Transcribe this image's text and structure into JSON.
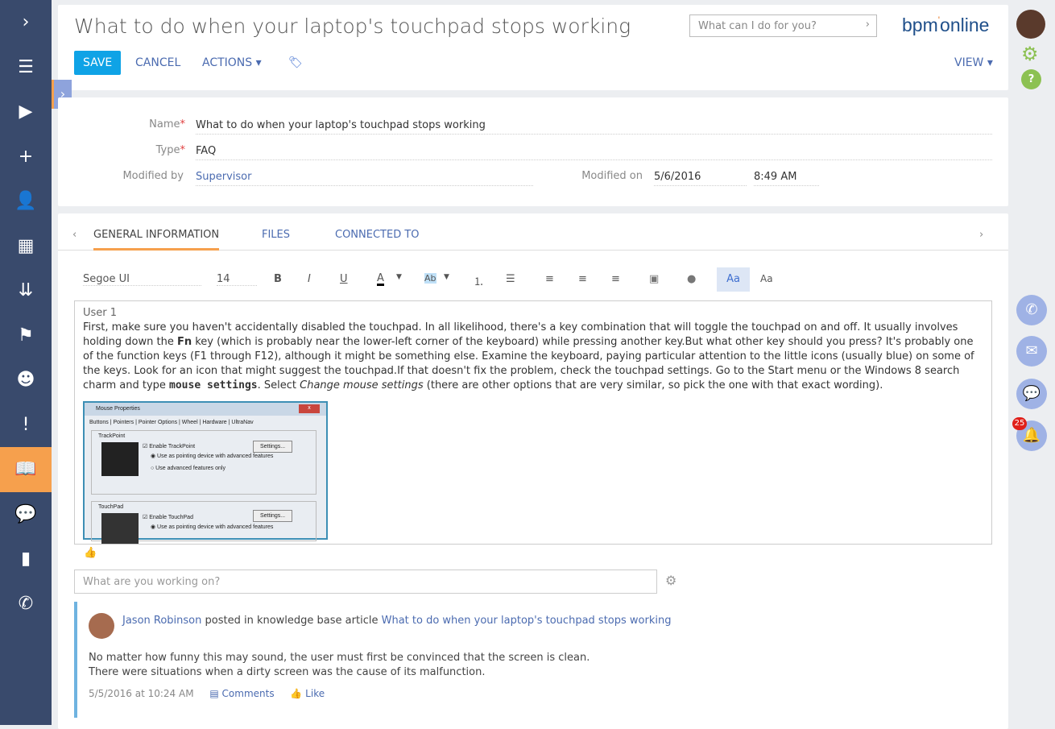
{
  "sidebar": {
    "items": [
      {
        "icon": "chevron-right-icon",
        "glyph": "›"
      },
      {
        "icon": "menu-icon",
        "glyph": "☰"
      },
      {
        "icon": "play-icon",
        "glyph": "▶"
      },
      {
        "icon": "plus-icon",
        "glyph": "+"
      },
      {
        "icon": "contact-icon",
        "glyph": "👤"
      },
      {
        "icon": "accounts-icon",
        "glyph": "▦"
      },
      {
        "icon": "leads-icon",
        "glyph": "⇊"
      },
      {
        "icon": "flag-icon",
        "glyph": "⚑"
      },
      {
        "icon": "agent-icon",
        "glyph": "☻"
      },
      {
        "icon": "cases-icon",
        "glyph": "!"
      },
      {
        "icon": "knowledge-base-icon",
        "glyph": "📖",
        "active": true
      },
      {
        "icon": "feed-icon",
        "glyph": "💬"
      },
      {
        "icon": "analytics-icon",
        "glyph": "▮"
      },
      {
        "icon": "phone-icon",
        "glyph": "✆"
      }
    ]
  },
  "header": {
    "title": "What to do when your laptop's touchpad stops working",
    "save": "SAVE",
    "cancel": "CANCEL",
    "actions": "ACTIONS ▾",
    "view": "VIEW ▾",
    "search_placeholder": "What can I do for you?",
    "logo": "bpm'online",
    "accent": "#0fa3e6"
  },
  "record": {
    "name_label": "Name",
    "name": "What to do when your laptop's touchpad stops working",
    "type_label": "Type",
    "type": "FAQ",
    "modified_by_label": "Modified by",
    "modified_by": "Supervisor",
    "modified_on_label": "Modified on",
    "modified_date": "5/6/2016",
    "modified_time": "8:49 AM"
  },
  "tabs": [
    "GENERAL INFORMATION",
    "FILES",
    "CONNECTED TO"
  ],
  "toolbar": {
    "font": "Segoe UI",
    "size": "14",
    "bold": "B",
    "italic": "I",
    "underline": "U",
    "color": "A",
    "highlight": "Ab",
    "style1": "Aa",
    "style2": "Aa"
  },
  "article": {
    "heading": "User 1",
    "p1": "First, make sure you haven't accidentally disabled the touchpad. In all likelihood, there's a key combination that will toggle the touchpad on and off. It usually involves holding down the ",
    "fn": "Fn",
    "p2": " key (which is probably near the lower-left corner of the keyboard) while pressing another key.But what other key should you press? It's probably one of the function keys (F1 through F12), although it might be something else. Examine the keyboard, paying particular attention to the little icons (usually blue) on some of the keys. Look for an icon that might suggest the touchpad.If that doesn't fix the problem, check the touchpad settings. Go to the Start menu or the Windows 8 search charm and type ",
    "code": "mouse settings",
    "p3": ". Select ",
    "em": "Change mouse settings",
    "p4": " (there are other options that are very similar, so pick the one with that exact wording).",
    "image": {
      "title": "Mouse Properties",
      "tabs": "Buttons | Pointers | Pointer Options | Wheel | Hardware | UltraNav",
      "trackpoint": "TrackPoint",
      "enable_trackpoint": "☑ Enable TrackPoint",
      "opt1": "◉ Use as pointing device with advanced features",
      "opt2": "○ Use advanced features only",
      "touchpad": "TouchPad",
      "enable_touchpad": "☑ Enable TouchPad",
      "opt3": "◉ Use as pointing device with advanced features",
      "settings": "Settings..."
    }
  },
  "feed": {
    "placeholder": "What are you working on?",
    "author": "Jason Robinson",
    "action": "posted in knowledge base article",
    "article": "What to do when your laptop's touchpad stops working",
    "text": "No matter how funny this may sound, the user must first be convinced that the screen is clean. There were situations when a dirty screen was the cause of its malfunction.",
    "date": "5/5/2016 at 10:24 AM",
    "comments": "Comments",
    "like": "Like"
  },
  "right": {
    "notifications": "25"
  }
}
